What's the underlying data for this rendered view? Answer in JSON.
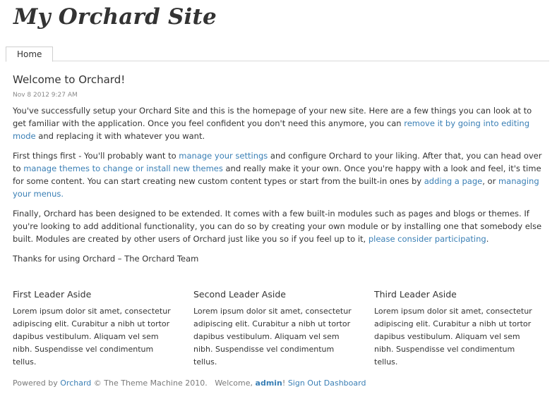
{
  "header": {
    "site_title": "My Orchard Site"
  },
  "nav": {
    "tabs": [
      {
        "label": "Home"
      }
    ]
  },
  "post": {
    "title": "Welcome to Orchard!",
    "date": "Nov 8 2012 9:27 AM",
    "p1": {
      "text_a": "You've successfully setup your Orchard Site and this is the homepage of your new site. Here are a few things you can look at to get familiar with the application. Once you feel confident you don't need this anymore, you can ",
      "link_remove": "remove it by going into editing mode",
      "text_b": " and replacing it with whatever you want."
    },
    "p2": {
      "text_a": "First things first - You'll probably want to ",
      "link_settings": "manage your settings",
      "text_b": " and configure Orchard to your liking. After that, you can head over to ",
      "link_themes": "manage themes to change or install new themes",
      "text_c": " and really make it your own. Once you're happy with a look and feel, it's time for some content. You can start creating new custom content types or start from the built-in ones by ",
      "link_page": "adding a page",
      "text_d": ", or ",
      "link_menus": "managing your menus."
    },
    "p3": {
      "text_a": "Finally, Orchard has been designed to be extended. It comes with a few built-in modules such as pages and blogs or themes. If you're looking to add additional functionality, you can do so by creating your own module or by installing one that somebody else built. Modules are created by other users of Orchard just like you so if you feel up to it, ",
      "link_participate": "please consider participating",
      "text_b": "."
    },
    "p4": {
      "text": "Thanks for using Orchard – The Orchard Team"
    }
  },
  "asides": [
    {
      "title": "First Leader Aside",
      "body": "Lorem ipsum dolor sit amet, consectetur adipiscing elit. Curabitur a nibh ut tortor dapibus vestibulum. Aliquam vel sem nibh. Suspendisse vel condimentum tellus."
    },
    {
      "title": "Second Leader Aside",
      "body": "Lorem ipsum dolor sit amet, consectetur adipiscing elit. Curabitur a nibh ut tortor dapibus vestibulum. Aliquam vel sem nibh. Suspendisse vel condimentum tellus."
    },
    {
      "title": "Third Leader Aside",
      "body": "Lorem ipsum dolor sit amet, consectetur adipiscing elit. Curabitur a nibh ut tortor dapibus vestibulum. Aliquam vel sem nibh. Suspendisse vel condimentum tellus."
    }
  ],
  "footer": {
    "powered_by": "Powered by ",
    "orchard_link": "Orchard",
    "copyright": " © The Theme Machine 2010.",
    "welcome": "Welcome, ",
    "user": "admin",
    "excl": "!",
    "sign_out": "Sign Out",
    "dashboard": "Dashboard"
  },
  "colors": {
    "link": "#3a7fb5",
    "text": "#333333",
    "muted": "#7a7a7a"
  }
}
